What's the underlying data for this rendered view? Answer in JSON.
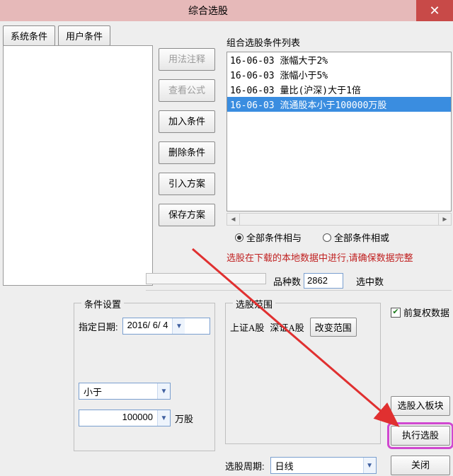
{
  "window": {
    "title": "综合选股"
  },
  "tabs": {
    "system_conditions": "系统条件",
    "user_conditions": "用户条件"
  },
  "side_buttons": {
    "usage_note": "用法注释",
    "view_formula": "查看公式",
    "add_condition": "加入条件",
    "delete_condition": "删除条件",
    "import_plan": "引入方案",
    "save_plan": "保存方案"
  },
  "condition_list": {
    "legend": "组合选股条件列表",
    "items": [
      "16-06-03 涨幅大于2%",
      "16-06-03 涨幅小于5%",
      "16-06-03 量比(沪深)大于1倍",
      "16-06-03 流通股本小于100000万股"
    ],
    "selected_index": 3
  },
  "radios": {
    "all_and": "全部条件相与",
    "all_or": "全部条件相或"
  },
  "warning_text": "选股在下载的本地数据中进行,请确保数据完整",
  "counts": {
    "total_label": "品种数",
    "total_value": "2862",
    "selected_label": "选中数"
  },
  "condition_settings": {
    "legend": "条件设置",
    "date_label": "指定日期:",
    "date_value": "2016/ 6/ 4",
    "operator": "小于",
    "amount": "100000",
    "unit": "万股"
  },
  "range": {
    "legend": "选股范围",
    "sh_a": "上证A股",
    "sz_a": "深证A股",
    "change_range": "改变范围"
  },
  "options": {
    "fuquan": "前复权数据"
  },
  "actions": {
    "into_block": "选股入板块",
    "execute": "执行选股",
    "close": "关闭"
  },
  "period": {
    "label": "选股周期:",
    "value": "日线"
  }
}
